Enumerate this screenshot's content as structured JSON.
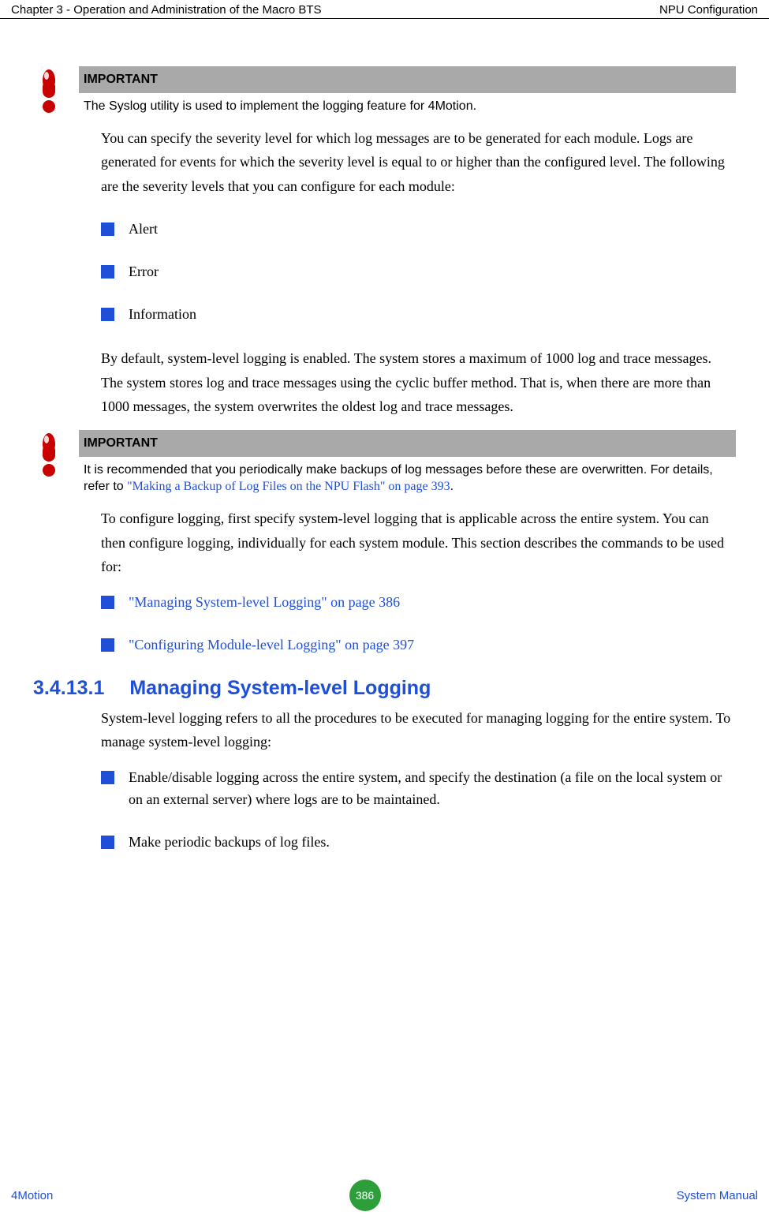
{
  "header": {
    "left": "Chapter 3 - Operation and Administration of the Macro BTS",
    "right": "NPU Configuration"
  },
  "important1": {
    "label": "IMPORTANT",
    "body": "The Syslog utility is used to implement the logging feature for 4Motion."
  },
  "para1": "You can specify the severity level for which log messages are to be generated for each module. Logs are generated for events for which the severity level is equal to or higher than the configured level. The following are the severity levels that you can configure for each module:",
  "list1": [
    "Alert",
    "Error",
    "Information"
  ],
  "para2": "By default, system-level logging is enabled. The system stores a maximum of 1000 log and trace messages. The system stores log and trace messages using the cyclic buffer method. That is, when there are more than 1000 messages, the system overwrites the oldest log and trace messages.",
  "important2": {
    "label": "IMPORTANT",
    "body_pre": "It is recommended that you periodically make backups of log messages before these are overwritten. For details, refer to ",
    "body_link": "\"Making a Backup of Log Files on the NPU Flash\" on page 393",
    "body_post": "."
  },
  "para3": "To configure logging, first specify system-level logging that is applicable across the entire system. You can then configure logging, individually for each system module. This section describes the commands to be used for:",
  "list2": [
    "\"Managing System-level Logging\" on page 386",
    "\"Configuring Module-level Logging\" on page 397"
  ],
  "heading": {
    "num": "3.4.13.1",
    "title": "Managing System-level Logging"
  },
  "para4": "System-level logging refers to all the procedures to be executed for managing logging for the entire system. To manage system-level logging:",
  "list3": [
    "Enable/disable logging across the entire system, and specify the destination (a file on the local system or on an external server) where logs are to be maintained.",
    "Make periodic backups of log files."
  ],
  "footer": {
    "left": "4Motion",
    "page": "386",
    "right": "System Manual"
  }
}
